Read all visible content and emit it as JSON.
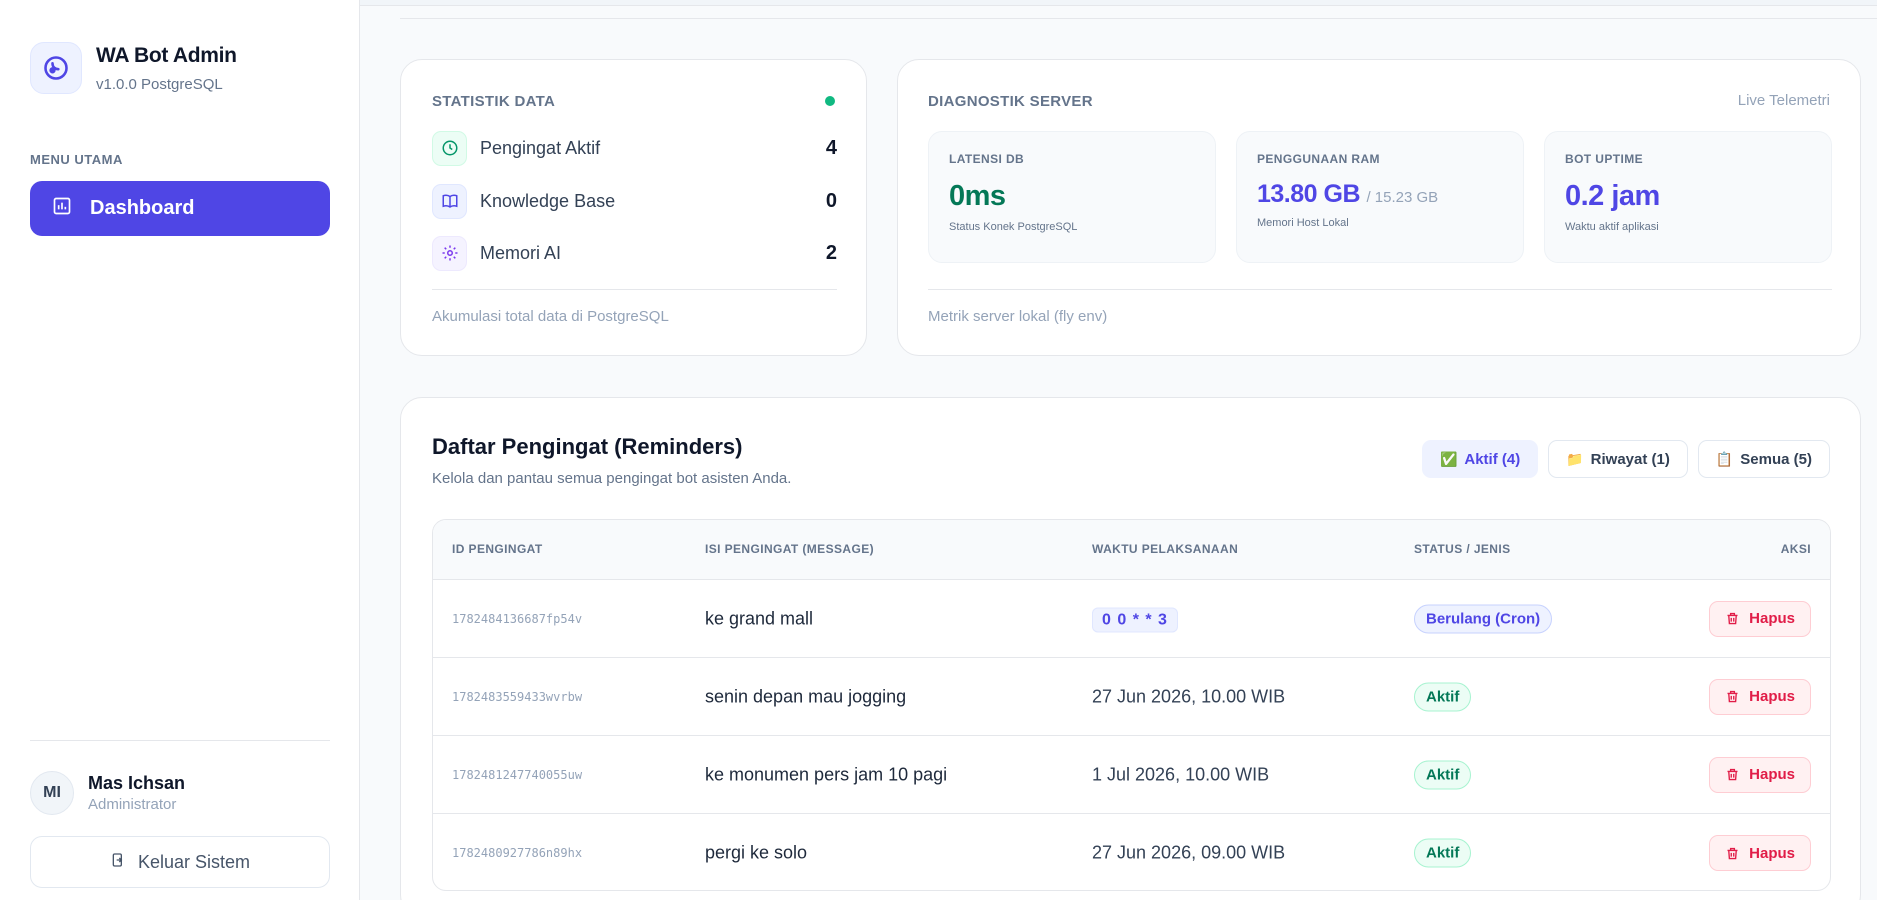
{
  "sidebar": {
    "brand_title": "WA Bot Admin",
    "brand_sub": "v1.0.0 PostgreSQL",
    "menu_label": "MENU UTAMA",
    "nav_active": "Dashboard",
    "user_initials": "MI",
    "user_name": "Mas Ichsan",
    "user_role": "Administrator",
    "logout_label": "Keluar Sistem"
  },
  "stats": {
    "title": "STATISTIK DATA",
    "rows": [
      {
        "label": "Pengingat Aktif",
        "value": "4",
        "icon": "clock-icon"
      },
      {
        "label": "Knowledge Base",
        "value": "0",
        "icon": "book-icon"
      },
      {
        "label": "Memori AI",
        "value": "2",
        "icon": "gear-icon"
      }
    ],
    "footer": "Akumulasi total data di PostgreSQL"
  },
  "diagnostics": {
    "title": "DIAGNOSTIK SERVER",
    "live": "Live Telemetri",
    "metrics": [
      {
        "title": "LATENSI DB",
        "value": "0ms",
        "extra": "",
        "sub": "Status Konek PostgreSQL",
        "color": "#047857"
      },
      {
        "title": "PENGGUNAAN RAM",
        "value": "13.80 GB",
        "extra": "/ 15.23 GB",
        "sub": "Memori Host Lokal",
        "color": "#4f46e5"
      },
      {
        "title": "BOT UPTIME",
        "value": "0.2 jam",
        "extra": "",
        "sub": "Waktu aktif aplikasi",
        "color": "#4f46e5"
      }
    ],
    "footer": "Metrik server lokal (fly env)"
  },
  "reminders": {
    "title": "Daftar Pengingat (Reminders)",
    "subtitle": "Kelola dan pantau semua pengingat bot asisten Anda.",
    "filters": [
      {
        "label": "Aktif (4)",
        "icon": "✅",
        "active": true
      },
      {
        "label": "Riwayat (1)",
        "icon": "📁",
        "active": false
      },
      {
        "label": "Semua (5)",
        "icon": "📋",
        "active": false
      }
    ],
    "columns": {
      "id": "ID PENGINGAT",
      "message": "ISI PENGINGAT (MESSAGE)",
      "time": "WAKTU PELAKSANAAN",
      "status": "STATUS / JENIS",
      "action": "AKSI"
    },
    "rows": [
      {
        "id": "1782484136687fp54v",
        "message": "ke grand mall",
        "time": "0 0 * * 3",
        "time_is_cron": true,
        "status": "Berulang (Cron)",
        "status_type": "cron",
        "action": "Hapus"
      },
      {
        "id": "1782483559433wvrbw",
        "message": "senin depan mau jogging",
        "time": "27 Jun 2026, 10.00 WIB",
        "time_is_cron": false,
        "status": "Aktif",
        "status_type": "aktif",
        "action": "Hapus"
      },
      {
        "id": "1782481247740055uw",
        "message": "ke monumen pers jam 10 pagi",
        "time": "1 Jul 2026, 10.00 WIB",
        "time_is_cron": false,
        "status": "Aktif",
        "status_type": "aktif",
        "action": "Hapus"
      },
      {
        "id": "1782480927786n89hx",
        "message": "pergi ke solo",
        "time": "27 Jun 2026, 09.00 WIB",
        "time_is_cron": false,
        "status": "Aktif",
        "status_type": "aktif",
        "action": "Hapus"
      }
    ]
  },
  "colors": {
    "accent": "#4f46e5",
    "success": "#10b981",
    "danger": "#e11d48"
  }
}
